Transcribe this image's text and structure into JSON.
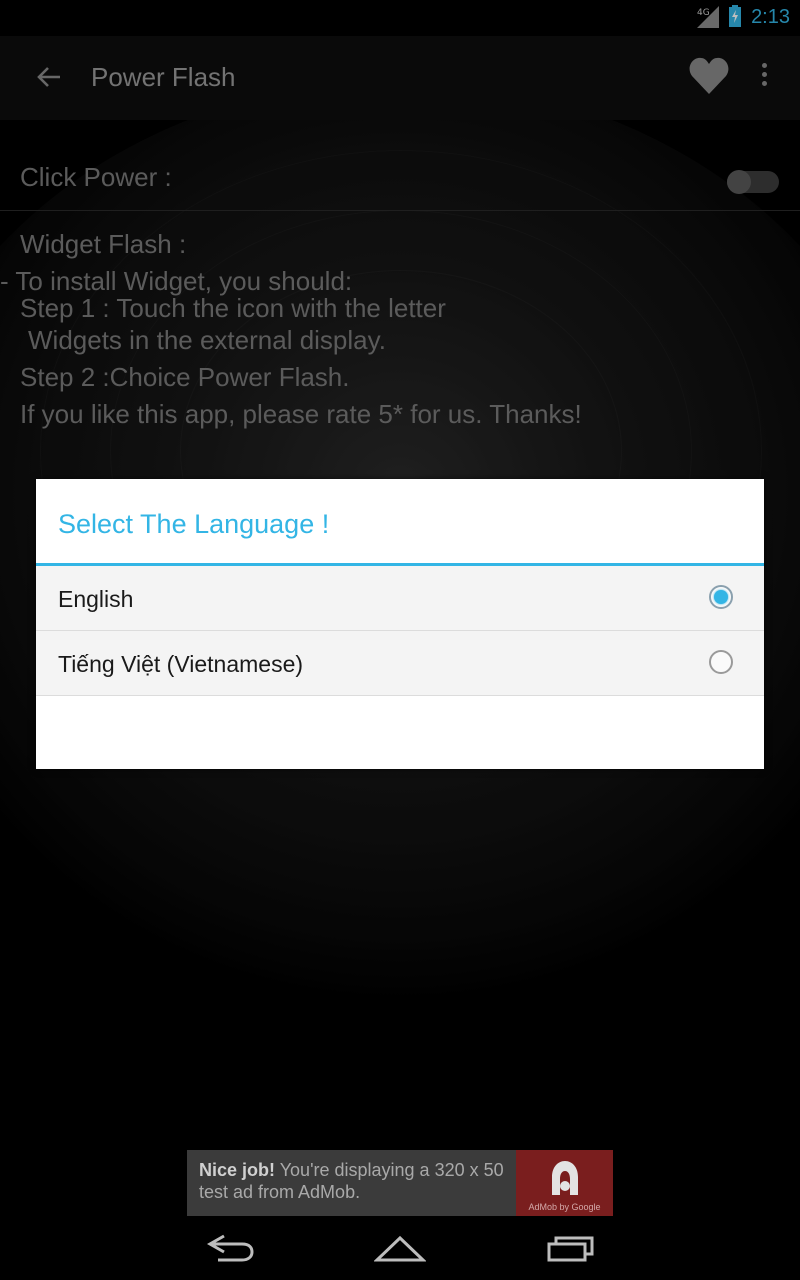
{
  "status_bar": {
    "network": "4G",
    "time": "2:13"
  },
  "action_bar": {
    "title": "Power Flash"
  },
  "settings": {
    "click_power_label": "Click Power :",
    "widget_flash_label": "Widget Flash :",
    "install_line": "- To install Widget, you should:",
    "step1_line1": "Step 1 : Touch the icon with the letter",
    "step1_line2": "Widgets in the external display.",
    "step2": "Step 2 :Choice Power Flash.",
    "rate": "If you like this app, please rate 5* for us. Thanks!",
    "click_power_enabled": false
  },
  "dialog": {
    "title": "Select The Language !",
    "options": [
      {
        "label": "English",
        "selected": true
      },
      {
        "label": "Tiếng Việt (Vietnamese)",
        "selected": false
      }
    ]
  },
  "ad": {
    "bold": "Nice job!",
    "text": " You're displaying a 320 x 50 test ad from AdMob.",
    "badge_caption": "AdMob by Google"
  },
  "colors": {
    "accent": "#33b5e5",
    "dialog_bg": "#ffffff",
    "ad_badge": "#7a1e1e"
  },
  "nav_icons": [
    "back-icon",
    "home-icon",
    "recent-apps-icon"
  ]
}
